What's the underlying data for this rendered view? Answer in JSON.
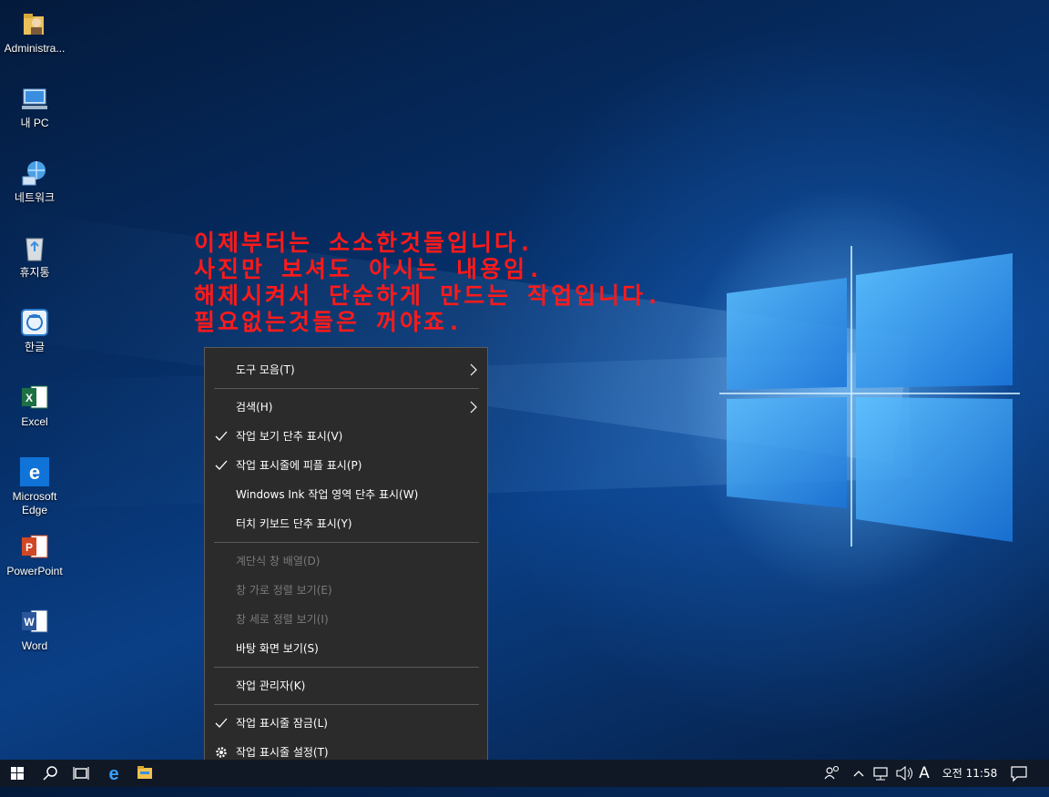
{
  "desktop": {
    "icons": [
      {
        "label": "Administra...",
        "icon": "user-folder-icon"
      },
      {
        "label": "내 PC",
        "icon": "computer-icon"
      },
      {
        "label": "네트워크",
        "icon": "network-icon"
      },
      {
        "label": "휴지통",
        "icon": "recycle-bin-icon"
      },
      {
        "label": "한글",
        "icon": "hangul-app-icon"
      },
      {
        "label": "Excel",
        "icon": "excel-icon"
      },
      {
        "label": "Microsoft\nEdge",
        "icon": "edge-icon"
      },
      {
        "label": "PowerPoint",
        "icon": "powerpoint-icon"
      },
      {
        "label": "Word",
        "icon": "word-icon"
      }
    ]
  },
  "overlay_note": {
    "lines": [
      "이제부터는 소소한것들입니다.",
      "사진만 보셔도 아시는 내용임.",
      "해제시켜서 단순하게 만드는 작업입니다.",
      "필요없는것들은 꺼야죠."
    ],
    "color": "#ff1a1a"
  },
  "context_menu": {
    "items": [
      {
        "label": "도구 모음(T)",
        "submenu": true
      },
      {
        "label": "검색(H)",
        "submenu": true
      },
      {
        "label": "작업 보기 단추 표시(V)",
        "checked": true
      },
      {
        "label": "작업 표시줄에 피플 표시(P)",
        "checked": true
      },
      {
        "label": "Windows Ink 작업 영역 단추 표시(W)"
      },
      {
        "label": "터치 키보드 단추 표시(Y)"
      },
      {
        "label": "계단식 창 배열(D)",
        "disabled": true
      },
      {
        "label": "창 가로 정렬 보기(E)",
        "disabled": true
      },
      {
        "label": "창 세로 정렬 보기(I)",
        "disabled": true
      },
      {
        "label": "바탕 화면 보기(S)"
      },
      {
        "label": "작업 관리자(K)"
      },
      {
        "label": "작업 표시줄 잠금(L)",
        "checked": true
      },
      {
        "label": "작업 표시줄 설정(T)",
        "icon": "gear-icon"
      }
    ]
  },
  "taskbar": {
    "buttons": [
      "start-icon",
      "search-icon",
      "task-view-icon",
      "edge-icon",
      "file-explorer-icon"
    ],
    "tray": {
      "ime": "A",
      "time": "오전 11:58",
      "icons": [
        "people-icon",
        "chevron-up-icon",
        "network-icon",
        "volume-icon",
        "notification-icon"
      ]
    }
  },
  "colors": {
    "menu_bg": "#2b2b2b",
    "taskbar_bg": "#101826",
    "accent": "#2f9bff"
  }
}
